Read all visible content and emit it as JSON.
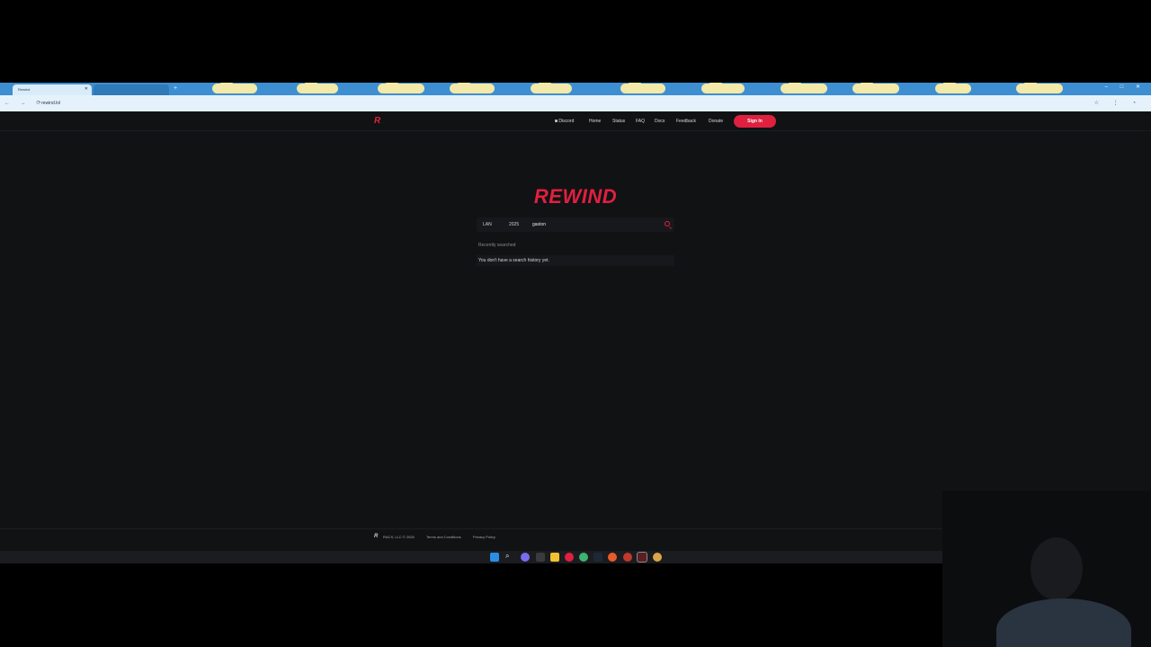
{
  "browser": {
    "tabs": [
      {
        "label": "Rewind",
        "active": true
      },
      {
        "label": "",
        "active": false
      }
    ],
    "new_tab": "+",
    "window_controls": "– □ ✕",
    "nav_buttons": "← → ⟳",
    "url": "rewind.lol",
    "right_icons": "☆ ⋮ ◔"
  },
  "site": {
    "logo": "R",
    "nav": {
      "discord": "Discord",
      "home": "Home",
      "status": "Status",
      "faq": "FAQ",
      "docs": "Docs",
      "feedback": "Feedback",
      "donate": "Donate",
      "signin": "Sign In"
    },
    "hero_title": "REWIND",
    "search": {
      "filter_mode": "LAN",
      "filter_year": "2025",
      "query": "gaston"
    },
    "history": {
      "header": "Recently searched",
      "empty": "You don't have a search history yet."
    },
    "footer": {
      "copyright": "RACS, LLC © 2026",
      "terms": "Terms and Conditions",
      "privacy": "Privacy Policy"
    }
  },
  "colors": {
    "accent": "#e0203f",
    "page_bg": "#111214",
    "tabstrip": "#3d8fd1"
  },
  "taskbar": {
    "icons": [
      "windows-start-icon",
      "search-icon",
      "copilot-icon",
      "file-explorer-icon",
      "terminal-icon",
      "app-icon",
      "chrome-icon",
      "steam-icon",
      "settings-icon",
      "firefox-icon",
      "app-icon-active",
      "app-icon-2"
    ]
  }
}
